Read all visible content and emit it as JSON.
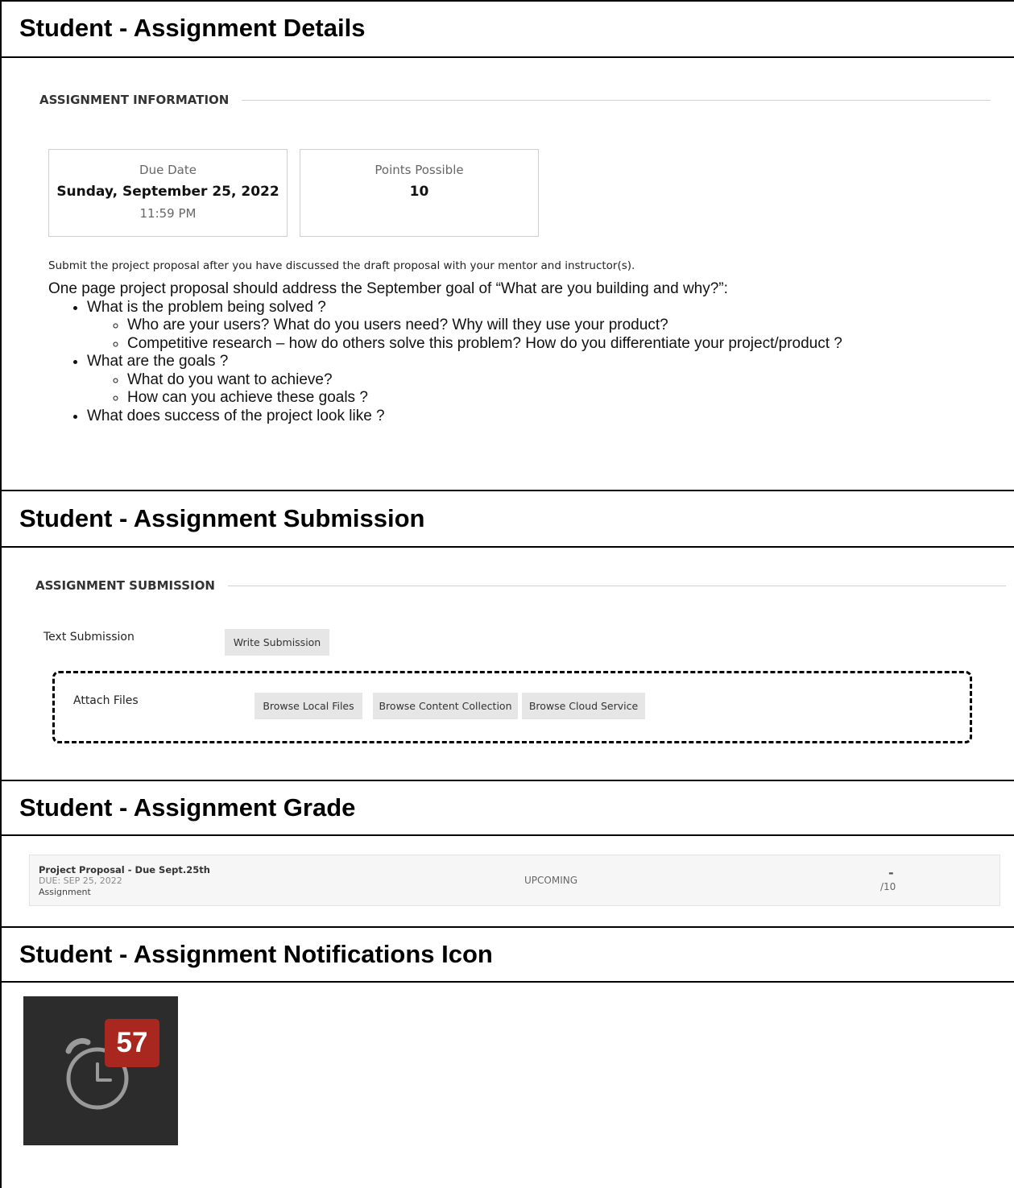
{
  "sections": {
    "details_title": "Student - Assignment Details",
    "submission_title": "Student - Assignment Submission",
    "grade_title": "Student - Assignment Grade",
    "notifications_title": "Student - Assignment Notifications Icon"
  },
  "assignment_info": {
    "heading": "ASSIGNMENT INFORMATION",
    "due_card": {
      "label": "Due Date",
      "date": "Sunday, September 25, 2022",
      "time": "11:59 PM"
    },
    "points_card": {
      "label": "Points Possible",
      "value": "10"
    },
    "instruction": "Submit the project proposal after you have discussed the draft proposal with your mentor and instructor(s).",
    "intro": "One page project proposal should address the September goal of “What are you building and why?”:",
    "bullets": [
      {
        "text": "What is the problem being solved ?",
        "sub": [
          "Who are your users? What do you users need? Why will they use your product?",
          "Competitive research – how do others solve this problem? How do you differentiate your project/product ?"
        ]
      },
      {
        "text": "What are the goals ?",
        "sub": [
          "What do you want to achieve?",
          "How can you achieve these goals ?"
        ]
      },
      {
        "text": "What does success of the project look like ?",
        "sub": []
      }
    ]
  },
  "submission": {
    "heading": "ASSIGNMENT SUBMISSION",
    "text_label": "Text Submission",
    "write_button": "Write Submission",
    "attach_label": "Attach Files",
    "buttons": [
      "Browse Local Files",
      "Browse Content Collection",
      "Browse Cloud Service"
    ]
  },
  "grade": {
    "name": "Project Proposal - Due Sept.25th",
    "due": "DUE: SEP 25, 2022",
    "type": "Assignment",
    "status": "UPCOMING",
    "score": "-",
    "out_of": "/10"
  },
  "notifications": {
    "count": "57",
    "icon": "alarm-clock-icon",
    "tile_color": "#2c2c2c",
    "badge_color": "#a8281f"
  }
}
